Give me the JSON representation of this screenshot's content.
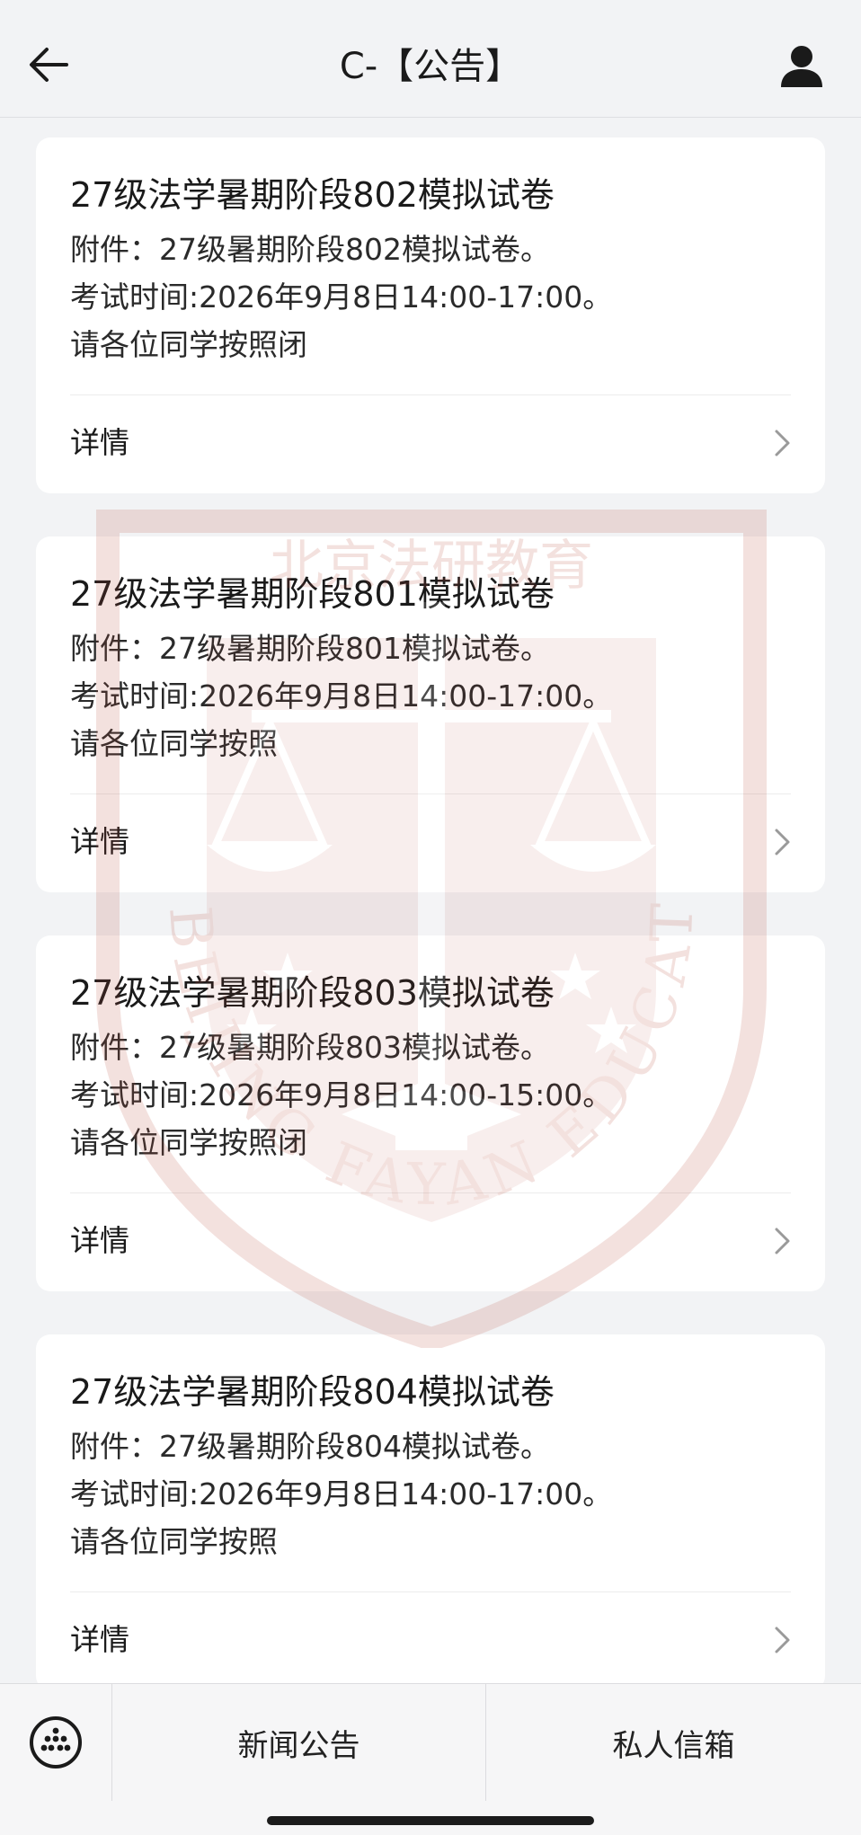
{
  "header": {
    "title": "C-【公告】",
    "back_icon": "arrow-left-icon",
    "user_icon": "user-icon"
  },
  "cards": [
    {
      "title": "27级法学暑期阶段802模拟试卷",
      "attachment": "附件：27级暑期阶段802模拟试卷。",
      "exam_time": "考试时间:2026年9月8日14:00-17:00。",
      "notice": "请各位同学按照闭",
      "detail_label": "详情"
    },
    {
      "title": "27级法学暑期阶段801模拟试卷",
      "attachment": "附件：27级暑期阶段801模拟试卷。",
      "exam_time": "考试时间:2026年9月8日14:00-17:00。",
      "notice": "请各位同学按照",
      "detail_label": "详情"
    },
    {
      "title": "27级法学暑期阶段803模拟试卷",
      "attachment": "附件：27级暑期阶段803模拟试卷。",
      "exam_time": "考试时间:2026年9月8日14:00-15:00。",
      "notice": "请各位同学按照闭",
      "detail_label": "详情"
    },
    {
      "title": "27级法学暑期阶段804模拟试卷",
      "attachment": "附件：27级暑期阶段804模拟试卷。",
      "exam_time": "考试时间:2026年9月8日14:00-17:00。",
      "notice": "请各位同学按照",
      "detail_label": "详情"
    }
  ],
  "watermark": {
    "text_arc": "BEIJING FAYAN EDUCATION",
    "text_top": "北京法研教育",
    "color": "#b84a3a"
  },
  "bottom_bar": {
    "menu_icon": "grid-dots-icon",
    "tabs": [
      {
        "label": "新闻公告"
      },
      {
        "label": "私人信箱"
      }
    ]
  }
}
